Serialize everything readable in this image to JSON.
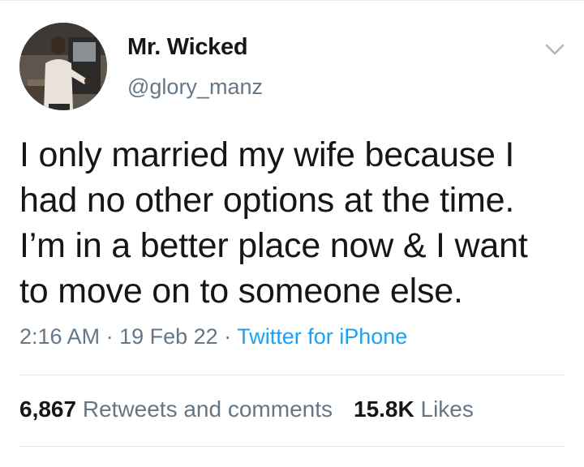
{
  "author": {
    "display_name": "Mr. Wicked",
    "handle": "@glory_manz"
  },
  "tweet": {
    "text_lines": [
      "I only married my wife because I",
      "had no other options at the time.",
      "I’m in a better place now & I want",
      "to move on to someone else."
    ],
    "time": "2:16 AM",
    "date": "19 Feb 22",
    "separator": "·",
    "source": "Twitter for iPhone"
  },
  "stats": {
    "retweets_count": "6,867",
    "retweets_label": "Retweets and comments",
    "likes_count": "15.8K",
    "likes_label": "Likes"
  },
  "colors": {
    "text_primary": "#14171a",
    "text_secondary": "#657786",
    "link": "#1da1f2",
    "divider": "#e1e8ed"
  },
  "icons": {
    "menu": "chevron-down-icon"
  }
}
